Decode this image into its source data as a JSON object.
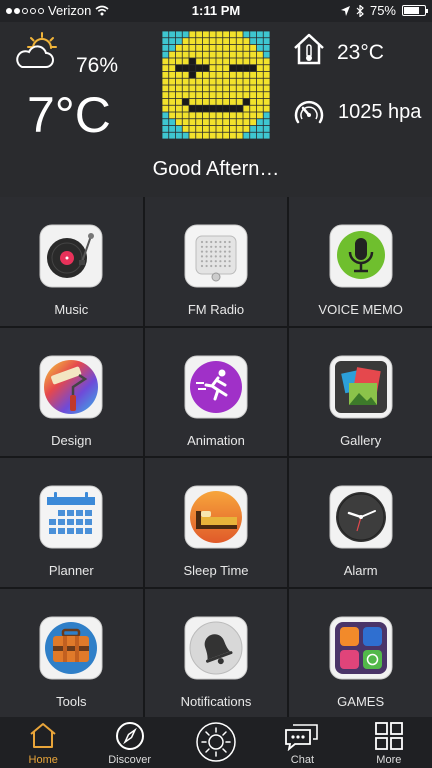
{
  "status_bar": {
    "carrier": "Verizon",
    "time": "1:11 PM",
    "battery": "75%",
    "battery_level": 0.75
  },
  "weather": {
    "humidity": "76%",
    "temperature": "7°C",
    "indoor_temp": "23°C",
    "pressure": "1025 hpa",
    "greeting": "Good Aftern…"
  },
  "apps": [
    {
      "label": "Music",
      "icon": "music-icon"
    },
    {
      "label": "FM Radio",
      "icon": "radio-icon"
    },
    {
      "label": "VOICE MEMO",
      "icon": "microphone-icon"
    },
    {
      "label": "Design",
      "icon": "paint-roller-icon"
    },
    {
      "label": "Animation",
      "icon": "running-icon"
    },
    {
      "label": "Gallery",
      "icon": "gallery-icon"
    },
    {
      "label": "Planner",
      "icon": "calendar-icon"
    },
    {
      "label": "Sleep Time",
      "icon": "bed-icon"
    },
    {
      "label": "Alarm",
      "icon": "clock-icon"
    },
    {
      "label": "Tools",
      "icon": "toolbox-icon"
    },
    {
      "label": "Notifications",
      "icon": "bell-icon"
    },
    {
      "label": "GAMES",
      "icon": "games-icon"
    }
  ],
  "tabs": [
    {
      "label": "Home",
      "icon": "house-icon"
    },
    {
      "label": "Discover",
      "icon": "compass-icon"
    },
    {
      "label": "",
      "icon": "sun-icon"
    },
    {
      "label": "Chat",
      "icon": "chat-icon"
    },
    {
      "label": "More",
      "icon": "grid-icon"
    }
  ],
  "colors": {
    "accent": "#e9a53a",
    "background": "#2c2d31",
    "face_yellow": "#f2e22c",
    "face_border": "#3ec6d0"
  }
}
